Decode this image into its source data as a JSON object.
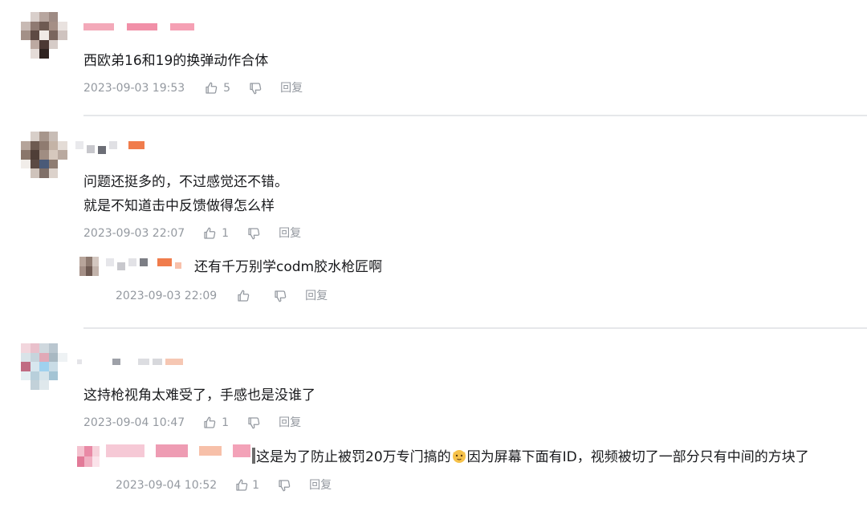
{
  "actions": {
    "reply_label": "回复"
  },
  "comments": [
    {
      "text": "西欧弟16和19的换弹动作合体",
      "time": "2023-09-03 19:53",
      "likes": "5"
    },
    {
      "text_lines": [
        "问题还挺多的，不过感觉还不错。",
        "就是不知道击中反馈做得怎么样"
      ],
      "time": "2023-09-03 22:07",
      "likes": "1",
      "reply": {
        "text": "还有千万别学codm胶水枪匠啊",
        "time": "2023-09-03 22:09"
      }
    },
    {
      "text": "这持枪视角太难受了，手感也是没谁了",
      "time": "2023-09-04 10:47",
      "likes": "1",
      "reply": {
        "text_before": "这是为了防止被罚20万专门搞的",
        "text_after": "因为屏幕下面有ID，视频被切了一部分只有中间的方块了",
        "time": "2023-09-04 10:52",
        "likes": "1"
      }
    }
  ]
}
